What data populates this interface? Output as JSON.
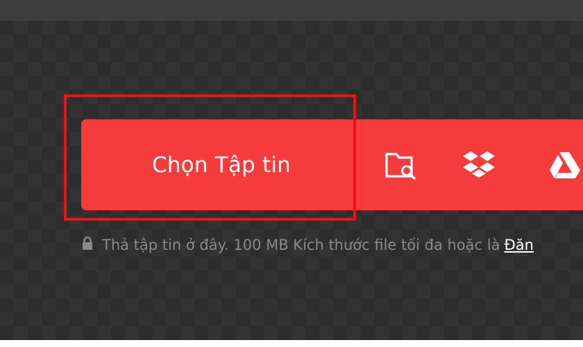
{
  "uploader": {
    "choose_label": "Chọn Tập tin",
    "sources": [
      {
        "name": "folder-search-icon"
      },
      {
        "name": "dropbox-icon"
      },
      {
        "name": "google-drive-icon"
      }
    ]
  },
  "hint": {
    "text": "Thả tập tin ở đây. 100 MB Kích thước file tối đa hoặc là",
    "link_label": "Đăn"
  },
  "colors": {
    "accent": "#f53b3b",
    "highlight": "#ee1111",
    "background": "#2d2d2d",
    "hint_text": "#8a8a8a"
  }
}
